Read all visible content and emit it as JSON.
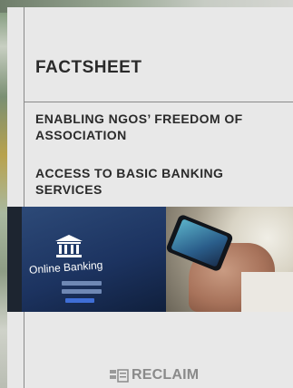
{
  "document": {
    "title": "FACTSHEET",
    "headings": [
      "ENABLING NGOS’ FREEDOM OF ASSOCIATION",
      "ACCESS TO BASIC BANKING SERVICES"
    ]
  },
  "photo": {
    "screen_label": "Online Banking"
  },
  "footer": {
    "logo_text": "RECLAIM"
  }
}
